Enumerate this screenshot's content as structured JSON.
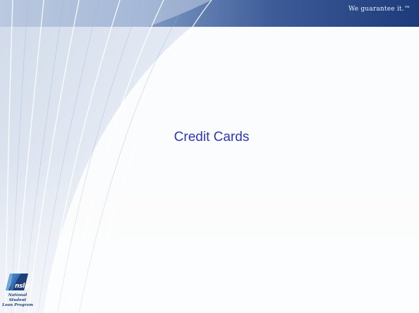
{
  "slide": {
    "tagline": "We guarantee it.™",
    "title": "Credit Cards"
  },
  "logo": {
    "abbr": "nslp",
    "name_line1": "National Student",
    "name_line2": "Loan Program"
  },
  "colors": {
    "header_dark": "#1d3a7a",
    "header_light": "#b8c8e0",
    "title_text": "#2e36b8",
    "logo_navy": "#1f3e7a",
    "logo_sky": "#6ea6d8"
  }
}
